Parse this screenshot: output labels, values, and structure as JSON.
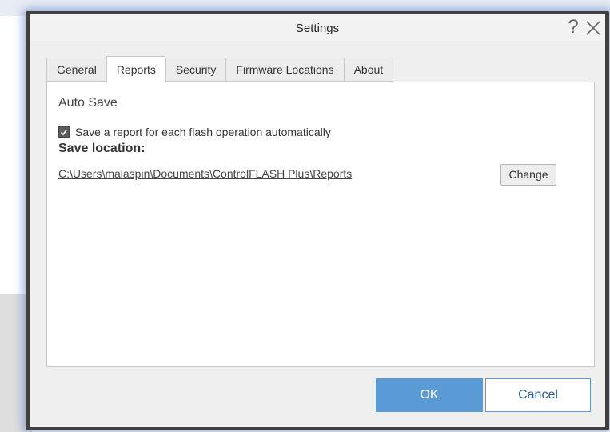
{
  "window": {
    "title": "Settings",
    "help_glyph": "?",
    "close_icon": "close-icon"
  },
  "tabs": [
    {
      "label": "General",
      "active": false
    },
    {
      "label": "Reports",
      "active": true
    },
    {
      "label": "Security",
      "active": false
    },
    {
      "label": "Firmware Locations",
      "active": false
    },
    {
      "label": "About",
      "active": false
    }
  ],
  "reports": {
    "section_title": "Auto Save",
    "auto_save_checkbox": {
      "label": "Save a report for each flash operation automatically",
      "checked": true
    },
    "save_location_label": "Save location:",
    "save_location_path": "C:\\Users\\malaspin\\Documents\\ControlFLASH Plus\\Reports",
    "change_button": "Change"
  },
  "footer": {
    "ok_button": "OK",
    "cancel_button": "Cancel"
  },
  "colors": {
    "accent": "#5b9bd5",
    "window_frame": "#404040",
    "dialog_background": "#efefef"
  }
}
